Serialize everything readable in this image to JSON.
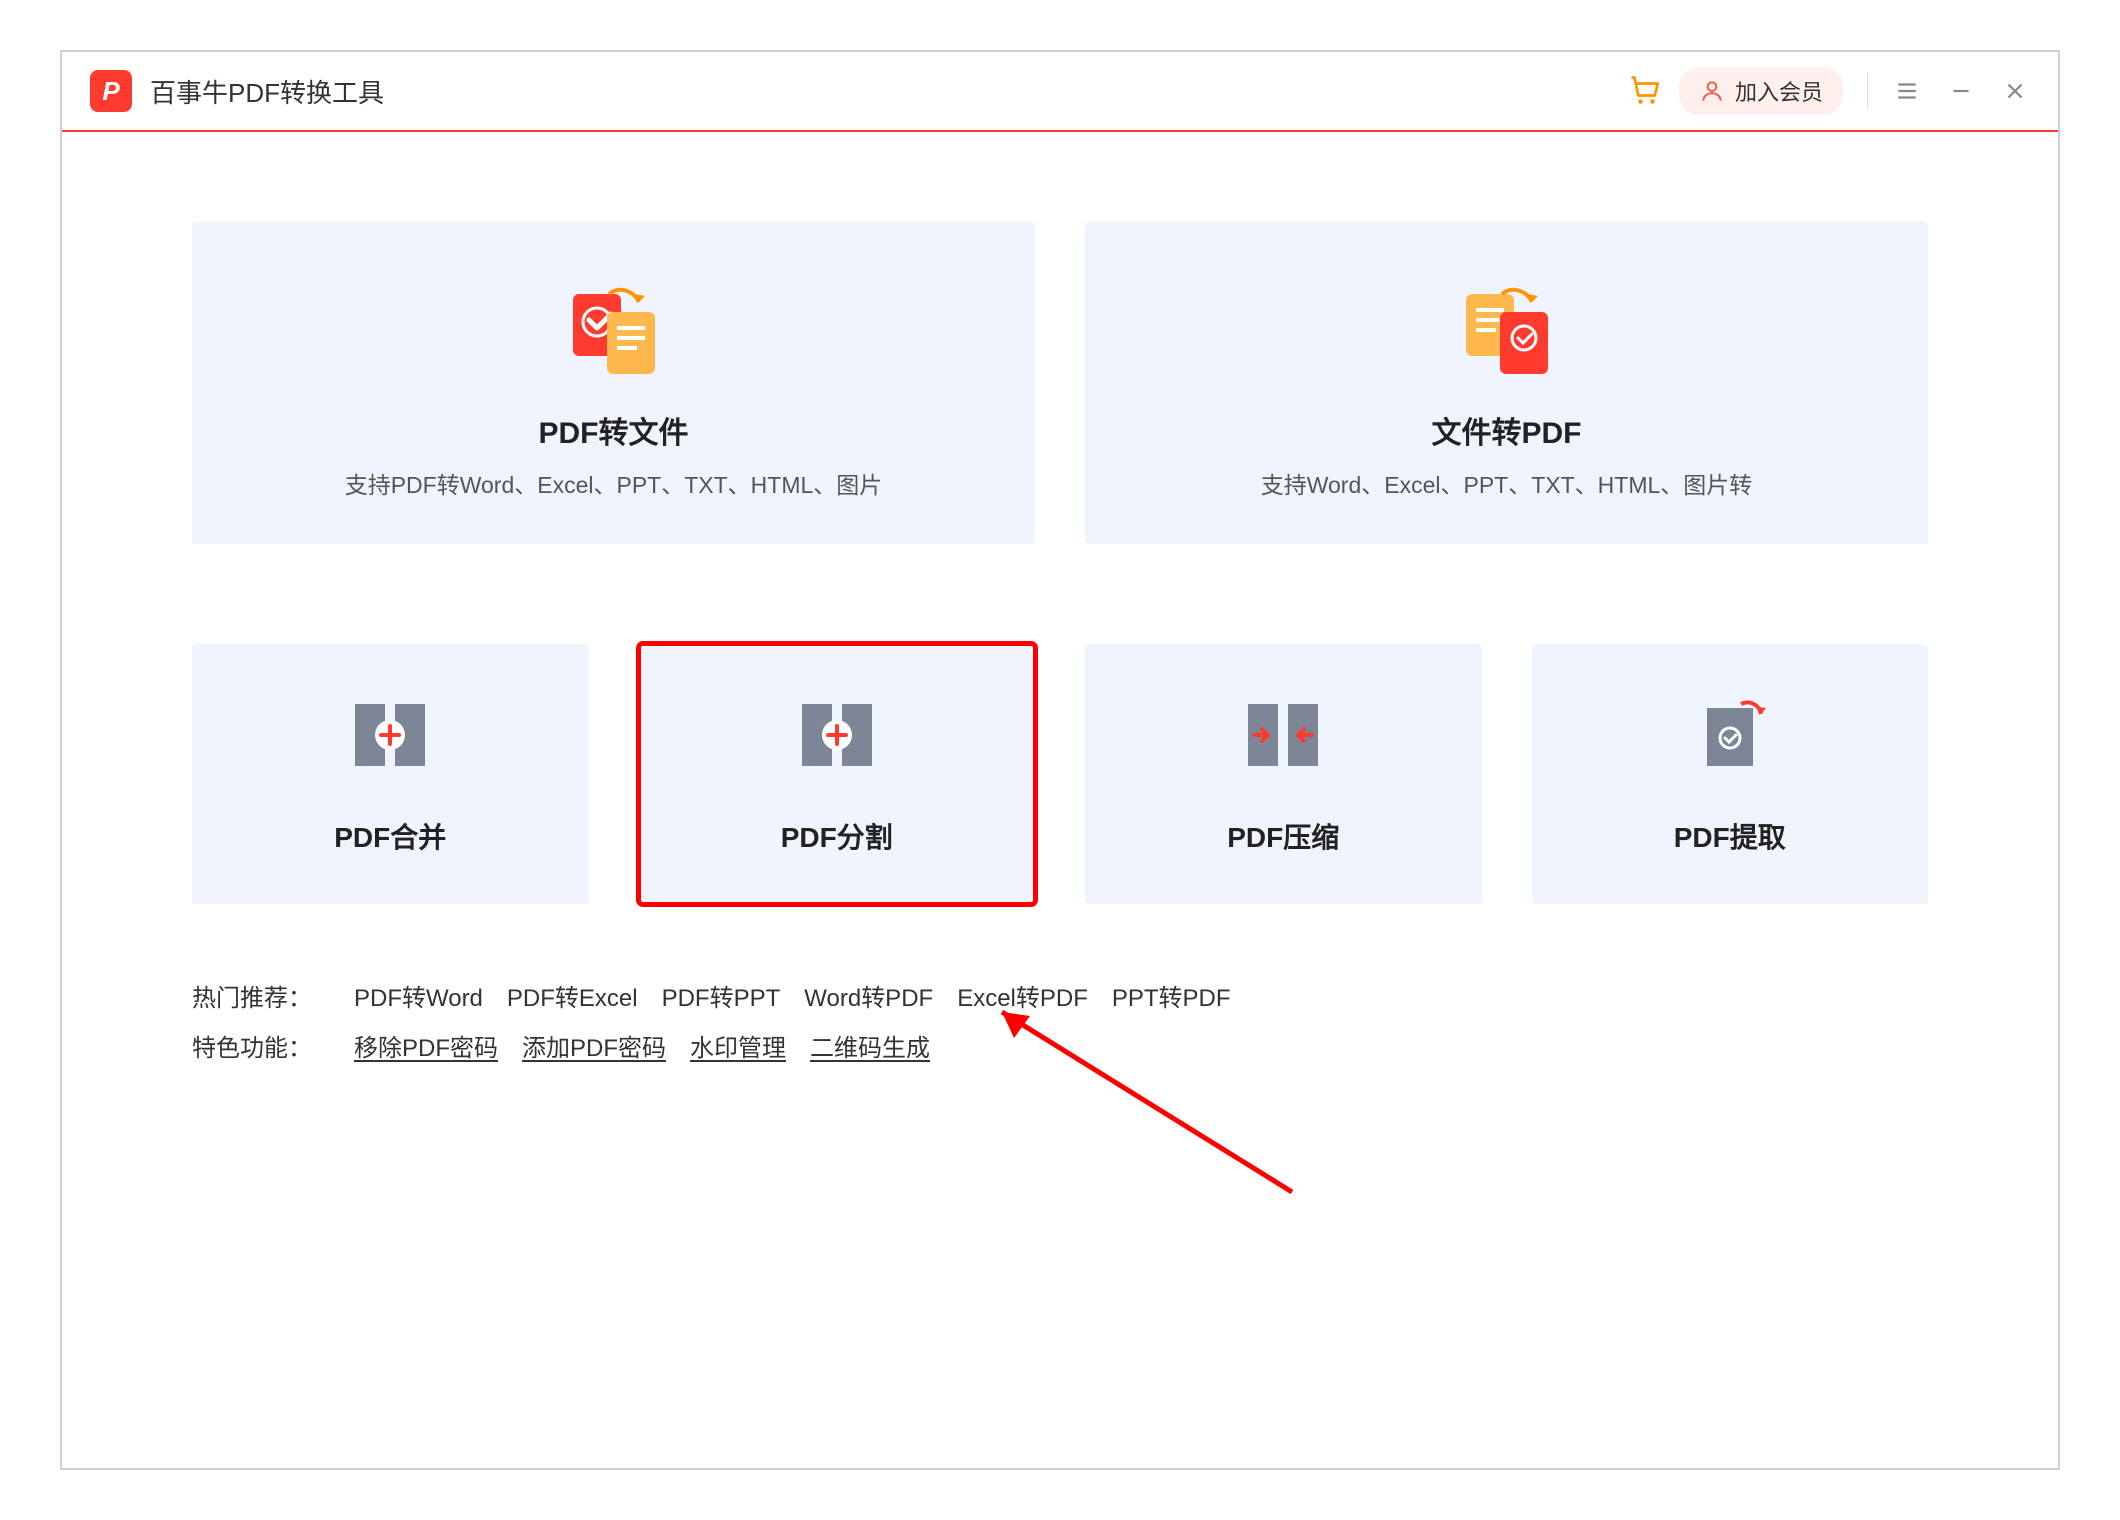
{
  "header": {
    "app_title": "百事牛PDF转换工具",
    "member_label": "加入会员"
  },
  "big_cards": [
    {
      "title": "PDF转文件",
      "desc": "支持PDF转Word、Excel、PPT、TXT、HTML、图片"
    },
    {
      "title": "文件转PDF",
      "desc": "支持Word、Excel、PPT、TXT、HTML、图片转"
    }
  ],
  "small_cards": [
    {
      "title": "PDF合并"
    },
    {
      "title": "PDF分割"
    },
    {
      "title": "PDF压缩"
    },
    {
      "title": "PDF提取"
    }
  ],
  "footer": {
    "popular_label": "热门推荐：",
    "popular_items": [
      "PDF转Word",
      "PDF转Excel",
      "PDF转PPT",
      "Word转PDF",
      "Excel转PDF",
      "PPT转PDF"
    ],
    "special_label": "特色功能：",
    "special_items": [
      "移除PDF密码",
      "添加PDF密码",
      "水印管理",
      "二维码生成"
    ]
  },
  "annotation": {
    "highlighted_card_index": 1
  }
}
